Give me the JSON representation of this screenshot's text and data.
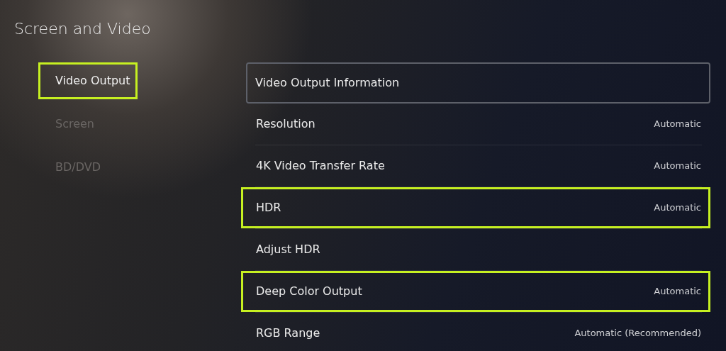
{
  "title": "Screen and Video",
  "sidebar": {
    "items": [
      {
        "label": "Video Output",
        "selected": true,
        "highlighted": true
      },
      {
        "label": "Screen",
        "selected": false,
        "highlighted": false
      },
      {
        "label": "BD/DVD",
        "selected": false,
        "highlighted": false
      }
    ]
  },
  "settings": [
    {
      "label": "Video Output Information",
      "focused": true,
      "highlighted": false
    },
    {
      "label": "Resolution",
      "value": "Automatic",
      "focused": false,
      "highlighted": false
    },
    {
      "label": "4K Video Transfer Rate",
      "value": "Automatic",
      "focused": false,
      "highlighted": false
    },
    {
      "label": "HDR",
      "value": "Automatic",
      "focused": false,
      "highlighted": true
    },
    {
      "label": "Adjust HDR",
      "focused": false,
      "highlighted": false
    },
    {
      "label": "Deep Color Output",
      "value": "Automatic",
      "focused": false,
      "highlighted": true
    },
    {
      "label": "RGB Range",
      "value": "Automatic (Recommended)",
      "focused": false,
      "highlighted": false
    }
  ]
}
